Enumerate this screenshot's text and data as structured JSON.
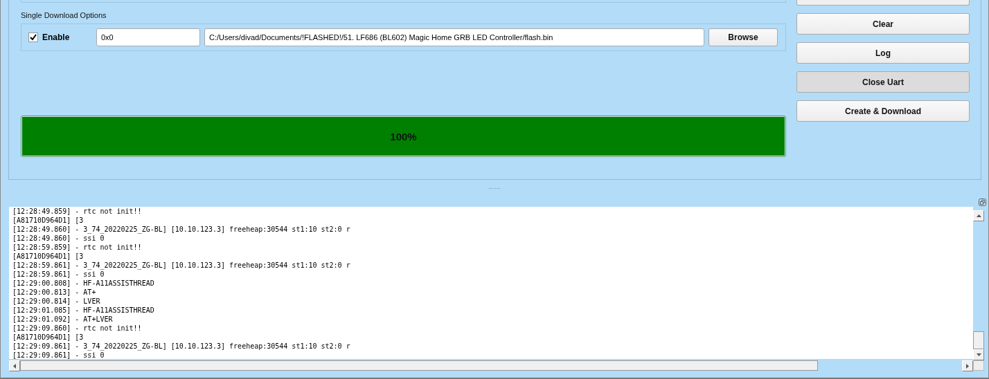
{
  "single_download": {
    "title": "Single Download Options",
    "enable": {
      "label": "Enable",
      "checked": true
    },
    "address": {
      "value": "0x0"
    },
    "file_path": {
      "value": "C:/Users/divad/Documents/!FLASHED!/51. LF686 (BL602) Magic Home GRB LED Controller/flash.bin"
    },
    "browse_button": "Browse"
  },
  "progress": {
    "level": 1,
    "label": "100%"
  },
  "buttons": [
    {
      "label": "Clear",
      "pressed": false
    },
    {
      "label": "Log",
      "pressed": false
    },
    {
      "label": "Close Uart",
      "pressed": true
    },
    {
      "label": "Create & Download",
      "pressed": false
    }
  ],
  "log_lines": [
    "[12:28:49.859] - rtc not init!!",
    "[A81710D964D1] [3",
    "[12:28:49.860] - 3_74_20220225_ZG-BL] [10.10.123.3] freeheap:30544 st1:10 st2:0 r",
    "[12:28:49.860] - ssi 0",
    "[12:28:59.859] - rtc not init!!",
    "[A81710D964D1] [3",
    "[12:28:59.861] - 3_74_20220225_ZG-BL] [10.10.123.3] freeheap:30544 st1:10 st2:0 r",
    "[12:28:59.861] - ssi 0",
    "[12:29:00.808] - HF-A11ASSISTHREAD",
    "[12:29:00.813] - AT+",
    "[12:29:00.814] - LVER",
    "[12:29:01.085] - HF-A11ASSISTHREAD",
    "[12:29:01.092] - AT+LVER",
    "[12:29:09.860] - rtc not init!!",
    "[A81710D964D1] [3",
    "[12:29:09.861] - 3_74_20220225_ZG-BL] [10.10.123.3] freeheap:30544 st1:10 st2:0 r",
    "[12:29:09.861] - ssi 0"
  ]
}
